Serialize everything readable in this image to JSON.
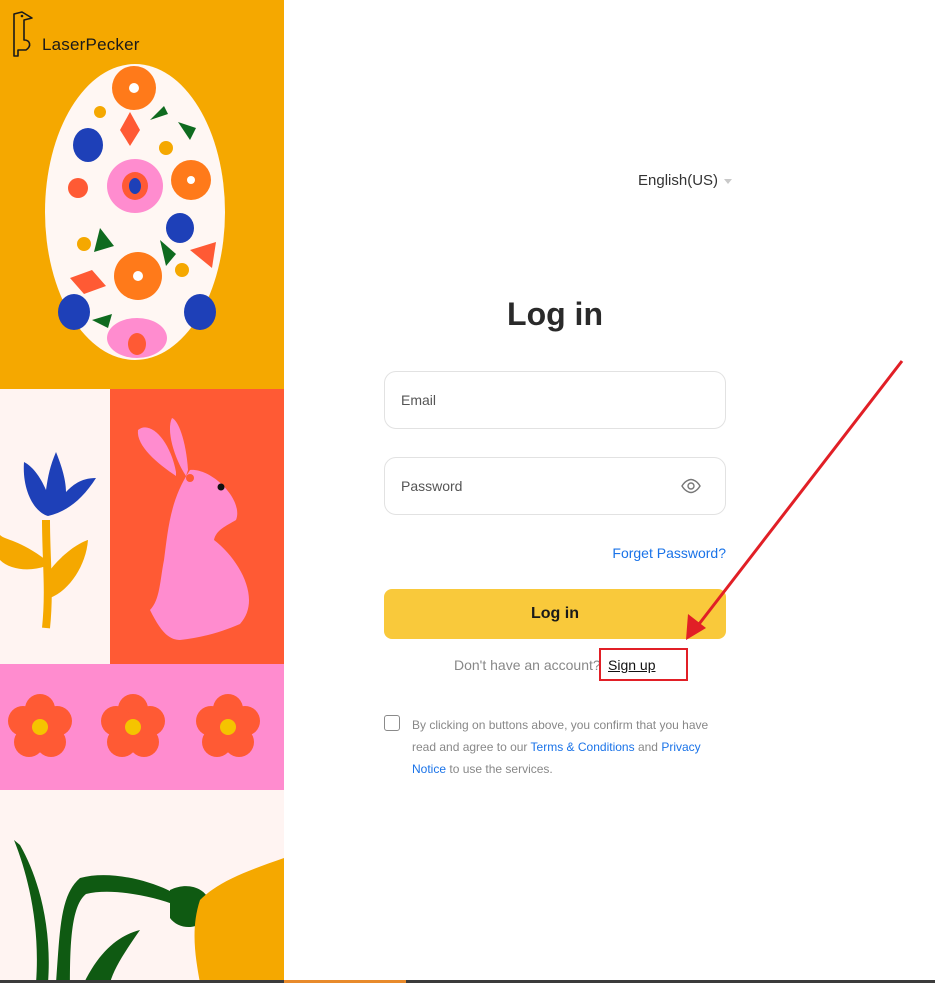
{
  "brand": {
    "name": "LaserPecker"
  },
  "language": {
    "selected": "English(US)"
  },
  "form": {
    "title": "Log in",
    "email_placeholder": "Email",
    "password_placeholder": "Password",
    "forgot_password": "Forget Password?",
    "login_button": "Log in",
    "no_account": "Don't have an account?",
    "signup_link": "Sign up"
  },
  "consent": {
    "text_before": "By clicking on buttons above, you confirm that you have read and agree to our",
    "terms_link": "Terms & Conditions",
    "text_and": "and",
    "privacy_link": "Privacy Notice",
    "text_after": "to use the services."
  },
  "colors": {
    "accent_yellow": "#f9c93b",
    "link_blue": "#1a73e8",
    "annotation_red": "#e11f26",
    "art_orange": "#f5a800",
    "art_red": "#ff5a34",
    "art_pink": "#ff8ccf"
  },
  "icons": {
    "password_toggle": "eye-icon",
    "language_caret": "caret-down-icon",
    "logo": "woodpecker-logo-icon"
  }
}
